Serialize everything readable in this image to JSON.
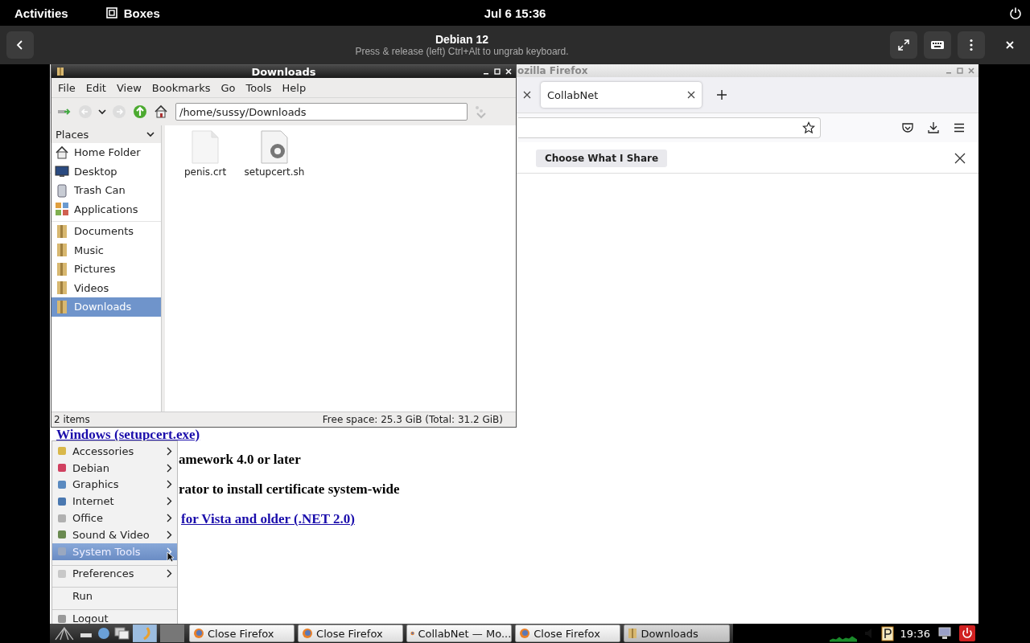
{
  "top_bar": {
    "activities": "Activities",
    "app": "Boxes",
    "clock": "Jul 6  15:36"
  },
  "boxes_header": {
    "title": "Debian 12",
    "subtitle": "Press & release (left) Ctrl+Alt to ungrab keyboard."
  },
  "firefox": {
    "title": "ozilla Firefox",
    "tabs": [
      {
        "label": "CollabNet",
        "selected": true
      }
    ],
    "notification": {
      "button": "Choose What I Share"
    },
    "page_lines": [
      {
        "kind": "link",
        "text": "Windows (setupcert.exe)"
      },
      {
        "kind": "text",
        "text": "amework 4.0 or later"
      },
      {
        "kind": "text",
        "text": "rator to install certificate system-wide"
      },
      {
        "kind": "link",
        "text": "for Vista and older (.NET 2.0)"
      }
    ]
  },
  "file_manager": {
    "title": "Downloads",
    "menu": [
      "File",
      "Edit",
      "View",
      "Bookmarks",
      "Go",
      "Tools",
      "Help"
    ],
    "path": "/home/sussy/Downloads",
    "places_label": "Places",
    "place_groups": [
      [
        {
          "label": "Home Folder",
          "kind": "home",
          "selected": false
        },
        {
          "label": "Desktop",
          "kind": "desktop",
          "selected": false
        },
        {
          "label": "Trash Can",
          "kind": "trash",
          "selected": false
        },
        {
          "label": "Applications",
          "kind": "apps",
          "selected": false
        }
      ],
      [
        {
          "label": "Documents",
          "kind": "folder",
          "selected": false
        },
        {
          "label": "Music",
          "kind": "folder",
          "selected": false
        },
        {
          "label": "Pictures",
          "kind": "folder",
          "selected": false
        },
        {
          "label": "Videos",
          "kind": "folder",
          "selected": false
        },
        {
          "label": "Downloads",
          "kind": "folder",
          "selected": true
        }
      ]
    ],
    "files": [
      {
        "name": "penis.crt",
        "kind": "blank"
      },
      {
        "name": "setupcert.sh",
        "kind": "script"
      }
    ],
    "status_count": "2 items",
    "status_space": "Free space: 25.3 GiB (Total: 31.2 GiB)"
  },
  "start_menu": {
    "groups": [
      [
        {
          "label": "Accessories",
          "kind": "submenu",
          "selected": false
        },
        {
          "label": "Debian",
          "kind": "submenu",
          "selected": false
        },
        {
          "label": "Graphics",
          "kind": "submenu",
          "selected": false
        },
        {
          "label": "Internet",
          "kind": "submenu",
          "selected": false
        },
        {
          "label": "Office",
          "kind": "submenu",
          "selected": false
        },
        {
          "label": "Sound & Video",
          "kind": "submenu",
          "selected": false
        },
        {
          "label": "System Tools",
          "kind": "submenu",
          "selected": true
        }
      ],
      [
        {
          "label": "Preferences",
          "kind": "submenu",
          "selected": false
        }
      ],
      [
        {
          "label": "Run",
          "kind": "plain",
          "selected": false
        }
      ],
      [
        {
          "label": "Logout",
          "kind": "plain",
          "selected": false
        }
      ]
    ]
  },
  "taskbar": {
    "tasks": [
      {
        "label": "Close Firefox",
        "kind": "firefox",
        "selected": false
      },
      {
        "label": "Close Firefox",
        "kind": "firefox",
        "selected": false
      },
      {
        "label": "CollabNet — Mo...",
        "kind": "firefox",
        "selected": false
      },
      {
        "label": "Close Firefox",
        "kind": "firefox",
        "selected": false
      },
      {
        "label": "Downloads",
        "kind": "folder",
        "selected": true
      }
    ],
    "clock": "19:36"
  }
}
